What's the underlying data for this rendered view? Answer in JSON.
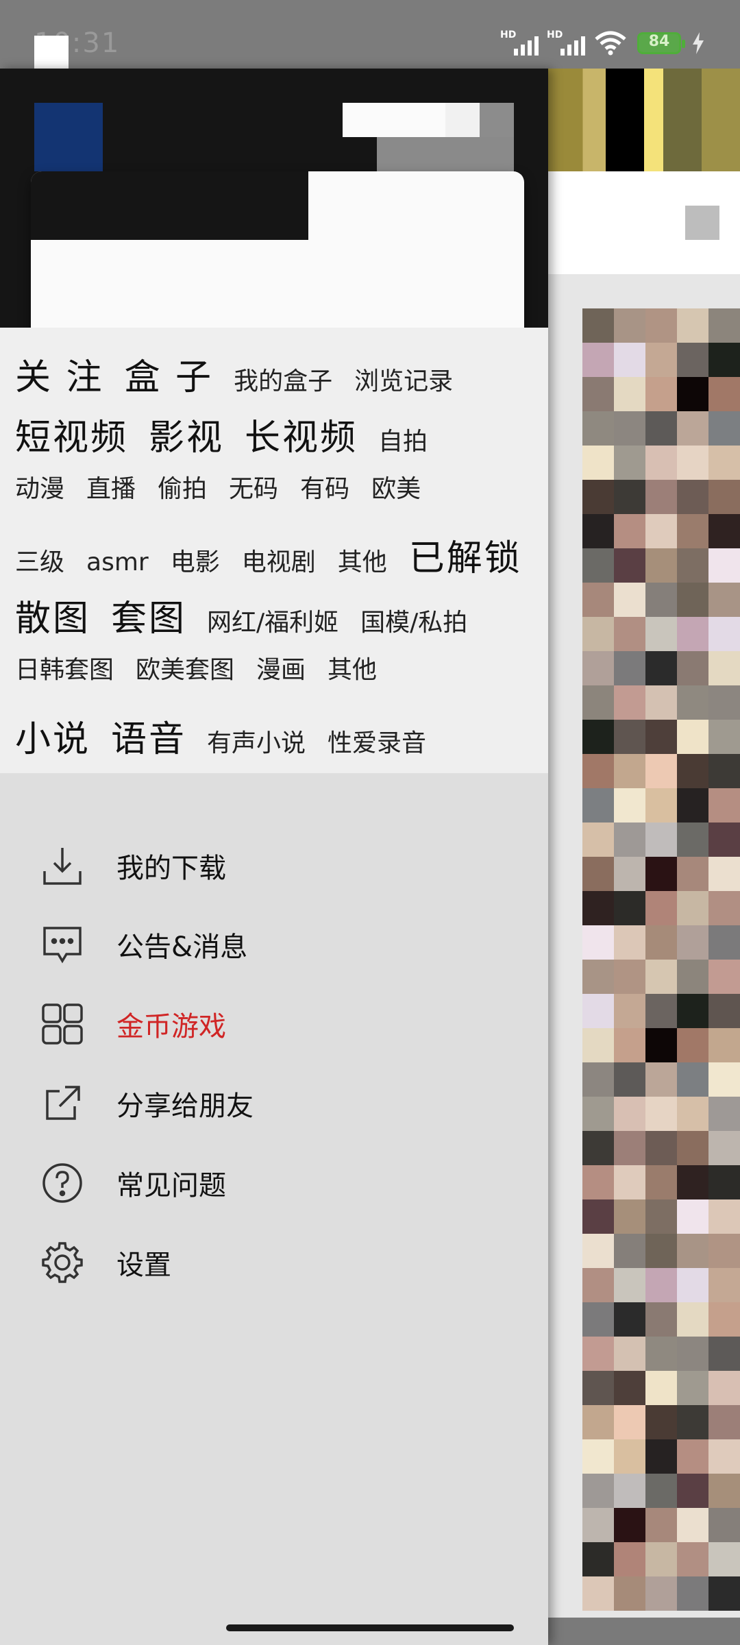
{
  "status_bar": {
    "time": "10:31",
    "battery": "84",
    "signal_label": "HD"
  },
  "drawer": {
    "categories": {
      "row1": {
        "big": [
          "关 注",
          "盒 子"
        ],
        "small": [
          "我的盒子",
          "浏览记录"
        ]
      },
      "row2": {
        "big": [
          "短视频",
          "影视",
          "长视频"
        ],
        "small": [
          "自拍"
        ]
      },
      "row3": {
        "small": [
          "动漫",
          "直播",
          "偷拍",
          "无码",
          "有码",
          "欧美"
        ]
      },
      "row4": {
        "small": [
          "三级",
          "asmr",
          "电影",
          "电视剧",
          "其他"
        ],
        "big": [
          "已解锁"
        ]
      },
      "row5": {
        "big": [
          "散图",
          "套图"
        ],
        "small": [
          "网红/福利姬",
          "国模/私拍"
        ]
      },
      "row6": {
        "small": [
          "日韩套图",
          "欧美套图",
          "漫画",
          "其他"
        ]
      },
      "row7": {
        "big": [
          "小说",
          "语音"
        ],
        "small": [
          "有声小说",
          "性爱录音"
        ]
      }
    },
    "menu": [
      {
        "label": "我的下载",
        "icon": "download-icon",
        "color": "#111111"
      },
      {
        "label": "公告&消息",
        "icon": "message-icon",
        "color": "#111111"
      },
      {
        "label": "金币游戏",
        "icon": "grid-icon",
        "color": "#d02525"
      },
      {
        "label": "分享给朋友",
        "icon": "share-icon",
        "color": "#111111"
      },
      {
        "label": "常见问题",
        "icon": "help-icon",
        "color": "#111111"
      },
      {
        "label": "设置",
        "icon": "gear-icon",
        "color": "#111111"
      }
    ]
  },
  "colors": {
    "accent_red": "#d02525",
    "header_bg": "#151515",
    "drawer_bg": "#dedede"
  }
}
